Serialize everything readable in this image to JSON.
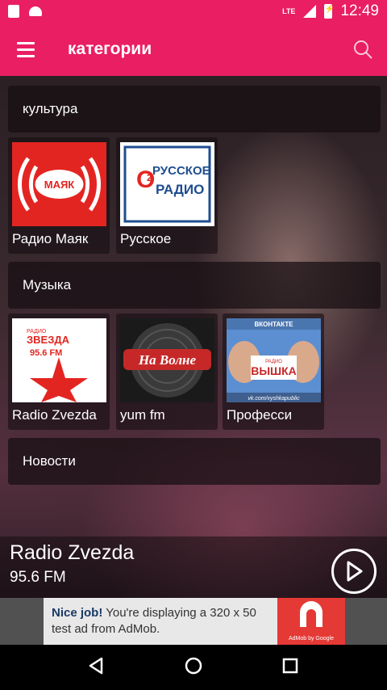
{
  "status_bar": {
    "network": "LTE",
    "time": "12:49"
  },
  "app_bar": {
    "title": "категории"
  },
  "categories": [
    {
      "title": "культура",
      "stations": [
        {
          "name": "Радио Маяк",
          "logo_text": "МАЯК"
        },
        {
          "name": "Русское",
          "logo_text_1": "РУССКОЕ",
          "logo_text_2": "РАДИО"
        }
      ]
    },
    {
      "title": "Музыка",
      "stations": [
        {
          "name": "Radio Zvezda",
          "logo_text_top": "РАДИО",
          "logo_text_name": "ЗВЕЗДА",
          "logo_text_freq": "95.6 FM"
        },
        {
          "name": "yum fm",
          "logo_text": "На Волне"
        },
        {
          "name": "Професси",
          "logo_text_top": "ВКОНТАКТЕ",
          "logo_text_name": "ВЫШКА",
          "logo_text_small": "РАДИО",
          "logo_text_url": "vk.com/vyshkapublic"
        }
      ]
    },
    {
      "title": "Новости",
      "stations": []
    }
  ],
  "player": {
    "title": "Radio Zvezda",
    "frequency": "95.6 FM"
  },
  "ad": {
    "bold": "Nice job!",
    "text": " You're displaying a 320 x 50 test ad from AdMob.",
    "logo_label": "AdMob by Google"
  },
  "colors": {
    "primary": "#e91e63",
    "mayak_red": "#e32521",
    "ad_red": "#e53935"
  }
}
